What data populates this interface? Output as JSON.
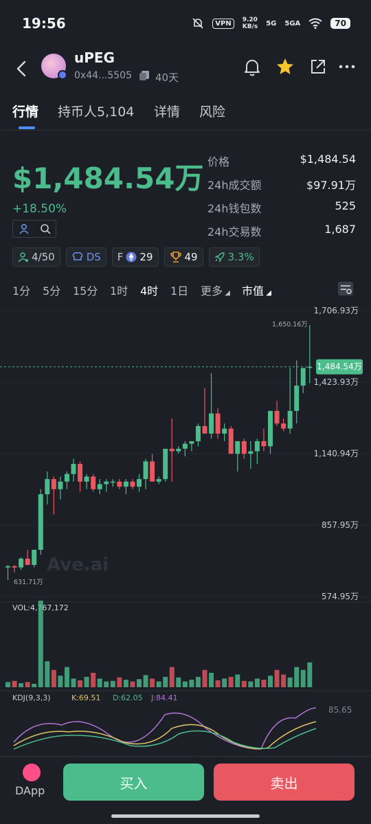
{
  "status": {
    "time": "19:56",
    "vpn": "VPN",
    "speed_top": "9.20",
    "speed_bottom": "KB/s",
    "net1": "5G",
    "net2": "5GA",
    "battery": "70"
  },
  "token": {
    "name": "uPEG",
    "address": "0x44...5505",
    "age": "40天"
  },
  "tabs": [
    {
      "label": "行情"
    },
    {
      "label": "持币人5,104"
    },
    {
      "label": "详情"
    },
    {
      "label": "风险"
    }
  ],
  "price": {
    "big": "$1,484.54万",
    "change": "+18.50%"
  },
  "stats": [
    {
      "k": "价格",
      "v": "$1,484.54"
    },
    {
      "k": "24h成交额",
      "v": "$97.91万"
    },
    {
      "k": "24h钱包数",
      "v": "525"
    },
    {
      "k": "24h交易数",
      "v": "1,687"
    }
  ],
  "badges": {
    "holders": "4/50",
    "ds": "DS",
    "f_label": "F",
    "f_value": "29",
    "trophy": "49",
    "rocket": "3.3%"
  },
  "timeframes": [
    "1分",
    "5分",
    "15分",
    "1时",
    "4时",
    "1日",
    "更多",
    "市值"
  ],
  "timeframe_active": "4时",
  "colors": {
    "up": "#4cbc8d",
    "down": "#e95761",
    "accent": "#4d8df7",
    "bg": "#1c1f26"
  },
  "chart_data": {
    "type": "candlestick",
    "unit": "万",
    "y_ticks": [
      "1,706.93万",
      "1,423.93万",
      "1,140.94万",
      "857.95万",
      "574.95万"
    ],
    "y_tick_values": [
      1706.93,
      1423.93,
      1140.94,
      857.95,
      574.95
    ],
    "high_label": "1,650.16万",
    "low_label": "631.71万",
    "current_label": "1,484.54万",
    "watermark": "Ave.ai",
    "candles": [
      [
        690,
        700,
        640,
        695
      ],
      [
        695,
        700,
        670,
        690
      ],
      [
        690,
        730,
        680,
        725
      ],
      [
        725,
        760,
        710,
        700
      ],
      [
        700,
        760,
        690,
        760
      ],
      [
        760,
        1000,
        740,
        980
      ],
      [
        980,
        1070,
        940,
        1040
      ],
      [
        1040,
        1050,
        900,
        1000
      ],
      [
        1000,
        1050,
        960,
        1030
      ],
      [
        1030,
        1070,
        1000,
        1060
      ],
      [
        1060,
        1120,
        1030,
        1100
      ],
      [
        1100,
        1110,
        990,
        1030
      ],
      [
        1030,
        1060,
        1000,
        1050
      ],
      [
        1050,
        1060,
        990,
        1000
      ],
      [
        1000,
        1040,
        980,
        1020
      ],
      [
        1020,
        1040,
        990,
        1030
      ],
      [
        1030,
        1040,
        1010,
        1030
      ],
      [
        1030,
        1040,
        1000,
        1010
      ],
      [
        1010,
        1040,
        980,
        1030
      ],
      [
        1030,
        1040,
        1000,
        1010
      ],
      [
        1010,
        1060,
        990,
        1040
      ],
      [
        1040,
        1120,
        1000,
        1110
      ],
      [
        1110,
        1140,
        1030,
        1030
      ],
      [
        1030,
        1050,
        1020,
        1040
      ],
      [
        1040,
        1160,
        1030,
        1160
      ],
      [
        1160,
        1280,
        1030,
        1150
      ],
      [
        1150,
        1170,
        1140,
        1160
      ],
      [
        1160,
        1190,
        1130,
        1180
      ],
      [
        1180,
        1190,
        1150,
        1190
      ],
      [
        1190,
        1260,
        1170,
        1250
      ],
      [
        1250,
        1400,
        1230,
        1220
      ],
      [
        1220,
        1460,
        1200,
        1300
      ],
      [
        1300,
        1320,
        1200,
        1220
      ],
      [
        1220,
        1260,
        1190,
        1240
      ],
      [
        1240,
        1250,
        1170,
        1140
      ],
      [
        1140,
        1170,
        1070,
        1190
      ],
      [
        1190,
        1200,
        1120,
        1140
      ],
      [
        1140,
        1190,
        1080,
        1150
      ],
      [
        1150,
        1200,
        1100,
        1190
      ],
      [
        1190,
        1240,
        1150,
        1170
      ],
      [
        1170,
        1310,
        1140,
        1310
      ],
      [
        1310,
        1350,
        1250,
        1260
      ],
      [
        1260,
        1280,
        1230,
        1240
      ],
      [
        1240,
        1480,
        1220,
        1310
      ],
      [
        1310,
        1510,
        1260,
        1410
      ],
      [
        1410,
        1470,
        1380,
        1480
      ],
      [
        1480,
        1650,
        1420,
        1484.54
      ]
    ],
    "volume_label": "VOL:4,767,172",
    "volumes": [
      18,
      22,
      14,
      18,
      12,
      300,
      90,
      60,
      40,
      70,
      30,
      24,
      36,
      50,
      30,
      20,
      22,
      34,
      26,
      20,
      28,
      42,
      30,
      20,
      36,
      70,
      34,
      20,
      26,
      36,
      60,
      50,
      24,
      30,
      36,
      44,
      22,
      20,
      30,
      26,
      40,
      60,
      44,
      34,
      70,
      60,
      86
    ],
    "kdj_label": "KDJ(9,3,3)",
    "kdj_k_label": "K:69.51",
    "kdj_d_label": "D:62.05",
    "kdj_j_label": "J:84.41",
    "kdj_max_label": "85.65"
  },
  "bottom": {
    "dapp": "DApp",
    "buy": "买入",
    "sell": "卖出"
  }
}
